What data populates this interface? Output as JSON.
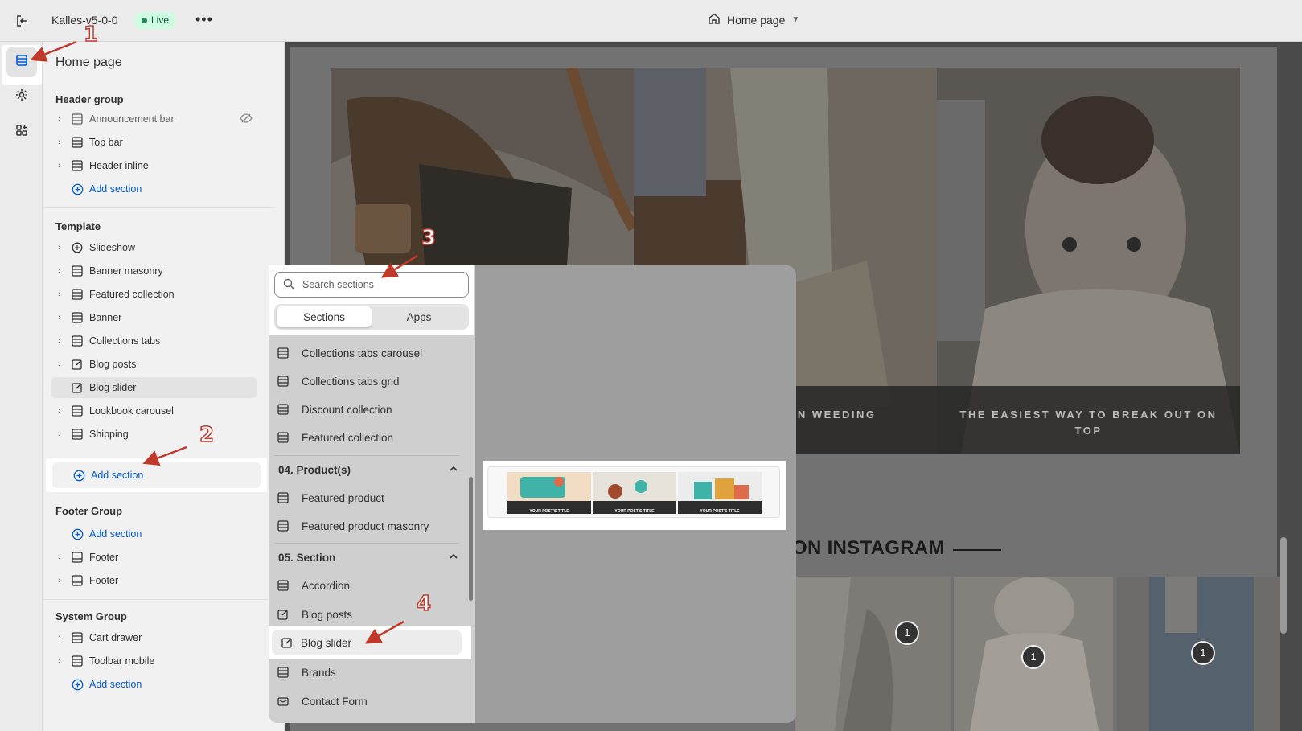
{
  "topbar": {
    "store_name": "Kalles-v5-0-0",
    "live_badge": "Live",
    "more_label": "•••",
    "page_selector": "Home page"
  },
  "sidebar": {
    "title": "Home page",
    "header_group": {
      "heading": "Header group",
      "items": [
        {
          "label": "Announcement bar",
          "hidden": true
        },
        {
          "label": "Top bar"
        },
        {
          "label": "Header inline"
        }
      ],
      "add_label": "Add section"
    },
    "template": {
      "heading": "Template",
      "items": [
        {
          "label": "Slideshow",
          "icon": "slideshow-icon"
        },
        {
          "label": "Banner masonry",
          "icon": "section-icon"
        },
        {
          "label": "Featured collection",
          "icon": "section-icon"
        },
        {
          "label": "Banner",
          "icon": "section-icon"
        },
        {
          "label": "Collections tabs",
          "icon": "section-icon"
        },
        {
          "label": "Blog posts",
          "icon": "blog-icon"
        },
        {
          "label": "Blog slider",
          "icon": "blog-icon",
          "selected": true
        },
        {
          "label": "Lookbook carousel",
          "icon": "section-icon"
        },
        {
          "label": "Shipping",
          "icon": "section-icon"
        }
      ],
      "add_label": "Add section"
    },
    "footer_group": {
      "heading": "Footer Group",
      "add_label": "Add section",
      "items": [
        {
          "label": "Footer"
        },
        {
          "label": "Footer"
        }
      ]
    },
    "system_group": {
      "heading": "System Group",
      "items": [
        {
          "label": "Cart drawer"
        },
        {
          "label": "Toolbar mobile"
        }
      ],
      "add_label": "Add section"
    }
  },
  "picker": {
    "search_placeholder": "Search sections",
    "tabs": [
      "Sections",
      "Apps"
    ],
    "active_tab": "Sections",
    "items_top": [
      "Collections tabs carousel",
      "Collections tabs grid",
      "Discount collection",
      "Featured collection"
    ],
    "category_products": "04. Product(s)",
    "items_products": [
      "Featured product",
      "Featured product masonry"
    ],
    "category_section": "05. Section",
    "items_section": [
      "Accordion",
      "Blog posts",
      "Blog slider",
      "Brands",
      "Contact Form"
    ],
    "preview_captions": [
      "YOUR POST'S TITLE",
      "YOUR POST'S TITLE",
      "YOUR POST'S TITLE"
    ]
  },
  "preview": {
    "caption_1": "LE IN WEEDING\nON",
    "caption_2": "THE EASIEST WAY TO BREAK OUT ON\nTOP",
    "instagram_title": "ON INSTAGRAM",
    "pin_label": "1"
  },
  "callouts": [
    "1",
    "2",
    "3",
    "4"
  ],
  "colors": {
    "accent_link": "#005bd3",
    "live_green": "#29845a",
    "annotation_red": "#c0392b"
  }
}
